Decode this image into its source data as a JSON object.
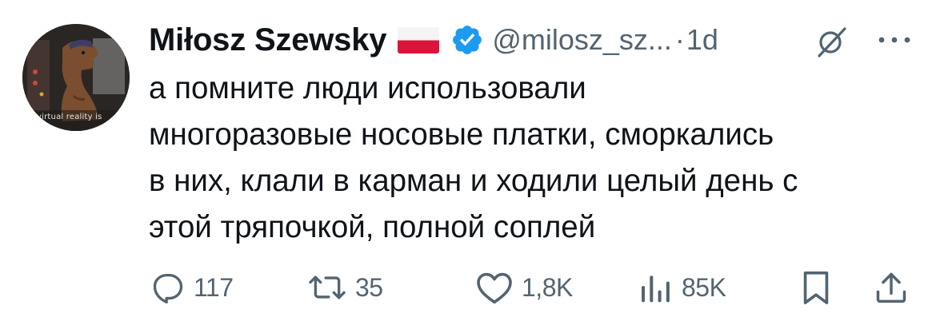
{
  "author": {
    "display_name": "Miłosz Szewsky",
    "flag": "poland-flag-icon",
    "verified_icon": "verified-badge-icon",
    "verified_color": "#1d9bf0",
    "handle": "@milosz_sz...",
    "separator": "·",
    "time": "1d",
    "avatar_caption": "virtual reality is"
  },
  "tweet": {
    "lines": [
      "а помните люди использовали",
      "многоразовые носовые платки, сморкались",
      "в них, клали в карман и ходили целый день с",
      "этой тряпочкой, полной соплей"
    ]
  },
  "actions": {
    "reply": {
      "icon": "reply-icon",
      "count": "117"
    },
    "repost": {
      "icon": "repost-icon",
      "count": "35"
    },
    "like": {
      "icon": "heart-icon",
      "count": "1,8K"
    },
    "views": {
      "icon": "views-chart-icon",
      "count": "85K"
    },
    "bookmark": {
      "icon": "bookmark-icon"
    },
    "share": {
      "icon": "share-icon"
    }
  },
  "colors": {
    "text_primary": "#0f1419",
    "text_secondary": "#536471",
    "accent": "#1d9bf0"
  }
}
